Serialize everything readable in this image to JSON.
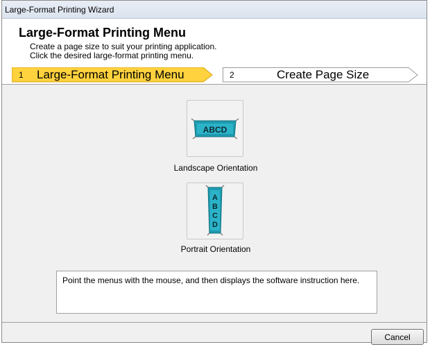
{
  "window": {
    "title": "Large-Format Printing Wizard"
  },
  "header": {
    "title": "Large-Format Printing Menu",
    "subtitle_lines": [
      "Create a page size to suit your printing application.",
      "Click the desired large-format printing menu."
    ]
  },
  "steps": [
    {
      "number": "1",
      "label": "Large-Format Printing Menu",
      "active": true,
      "color": "#ffd23e"
    },
    {
      "number": "2",
      "label": "Create Page Size",
      "active": false,
      "color": "#ffffff"
    }
  ],
  "options": [
    {
      "icon_text": "ABCD",
      "caption": "Landscape Orientation",
      "icon": "landscape-orientation-icon"
    },
    {
      "icon_text": "ABCD",
      "caption": "Portrait Orientation",
      "icon": "portrait-orientation-icon"
    }
  ],
  "info": {
    "text": "Point the menus with the mouse, and then displays the software instruction here."
  },
  "buttons": {
    "cancel": "Cancel"
  },
  "colors": {
    "accent_teal": "#1e9bb0",
    "step_active": "#ffd23e"
  }
}
